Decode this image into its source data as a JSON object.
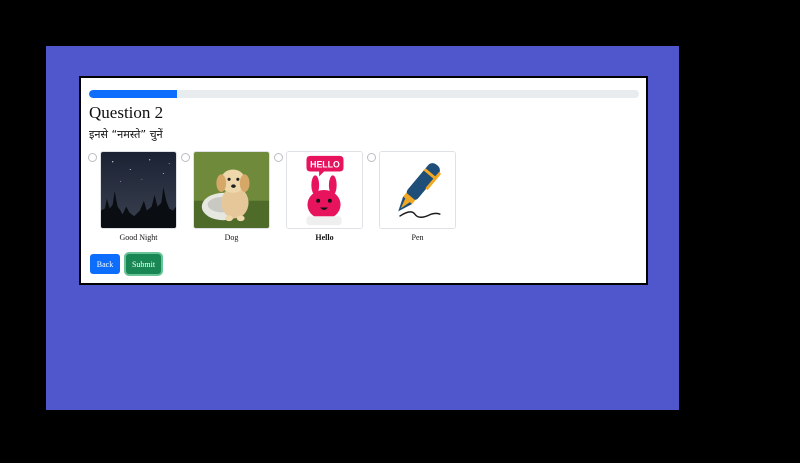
{
  "question": {
    "title": "Question 2",
    "prompt": "इनसे “नमस्ते” चुनें",
    "progress_percent": 16
  },
  "options": [
    {
      "label": "Good Night",
      "image": "night-sky-trees",
      "selected": false
    },
    {
      "label": "Dog",
      "image": "puppy",
      "selected": false
    },
    {
      "label": "Hello",
      "image": "hello-bunny",
      "selected": false
    },
    {
      "label": "Pen",
      "image": "fountain-pen",
      "selected": false
    }
  ],
  "buttons": {
    "back_label": "Back",
    "submit_label": "Submit"
  },
  "colors": {
    "page_bg": "#000000",
    "stage_bg": "#5056cc",
    "progress_fill": "#0d6efd",
    "back_button": "#0d6efd",
    "submit_button": "#198754"
  }
}
